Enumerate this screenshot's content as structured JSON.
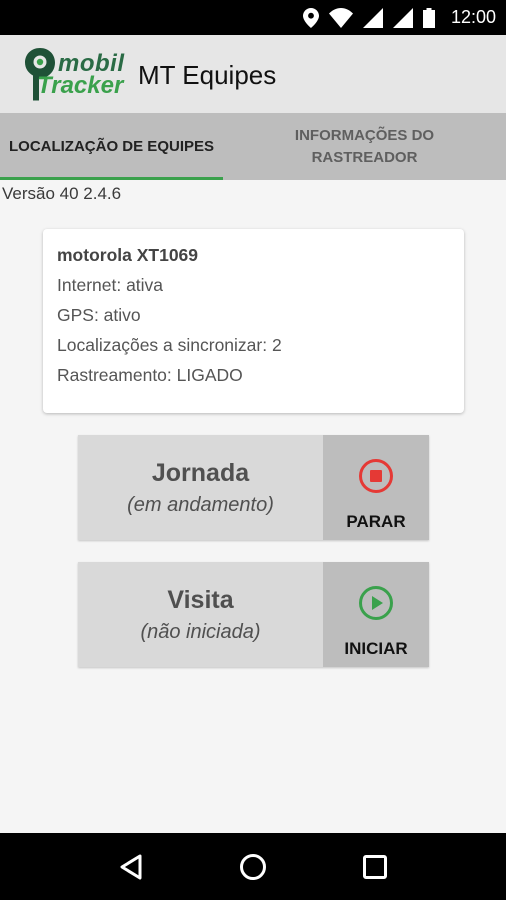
{
  "status_bar": {
    "time": "12:00"
  },
  "app_bar": {
    "logo": {
      "line1": "mobil",
      "line2": "Tracker"
    },
    "title": "MT Equipes"
  },
  "tabs": [
    {
      "label": "LOCALIZAÇÃO DE EQUIPES",
      "active": true
    },
    {
      "label": "INFORMAÇÕES DO RASTREADOR",
      "active": false
    }
  ],
  "version": "Versão 40 2.4.6",
  "device_card": {
    "device": "motorola XT1069",
    "internet": "Internet: ativa",
    "gps": "GPS: ativo",
    "sync": "Localizações a sincronizar: 2",
    "tracking": "Rastreamento: LIGADO"
  },
  "actions": {
    "jornada": {
      "name": "Jornada",
      "state": "(em andamento)",
      "button": "PARAR",
      "icon": "stop-icon",
      "color": "#e53935"
    },
    "visita": {
      "name": "Visita",
      "state": "(não iniciada)",
      "button": "INICIAR",
      "icon": "play-icon",
      "color": "#3aa14c"
    }
  }
}
